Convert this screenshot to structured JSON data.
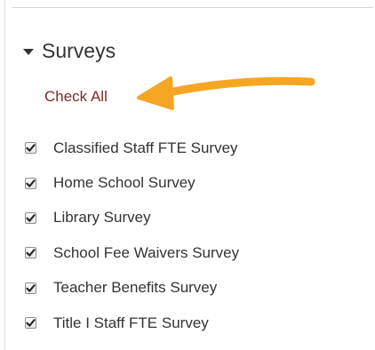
{
  "section": {
    "title": "Surveys",
    "caret_icon": "caret-down-icon",
    "check_all_label": "Check All"
  },
  "annotation": {
    "icon": "arrow-left-icon",
    "color": "#f5a623"
  },
  "surveys": {
    "items": [
      {
        "label": "Classified Staff FTE Survey",
        "checked": true
      },
      {
        "label": "Home School Survey",
        "checked": true
      },
      {
        "label": "Library Survey",
        "checked": true
      },
      {
        "label": "School Fee Waivers Survey",
        "checked": true
      },
      {
        "label": "Teacher Benefits Survey",
        "checked": true
      },
      {
        "label": "Title I Staff FTE Survey",
        "checked": true
      }
    ]
  },
  "colors": {
    "link": "#7a2b2b",
    "text": "#333333"
  }
}
